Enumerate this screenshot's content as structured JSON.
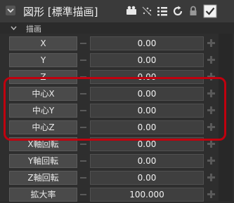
{
  "header": {
    "title": "図形 [標準描画]",
    "icons": [
      "camera-icon",
      "effect-icon",
      "list-icon",
      "refresh-icon",
      "lock-icon",
      "checkbox-icon"
    ]
  },
  "section": {
    "label": "描画"
  },
  "rows": [
    {
      "label": "X",
      "value": "0.00"
    },
    {
      "label": "Y",
      "value": "0.00"
    },
    {
      "label": "Z",
      "value": "0.00"
    },
    {
      "label": "中心X",
      "value": "0.00"
    },
    {
      "label": "中心Y",
      "value": "0.00"
    },
    {
      "label": "中心Z",
      "value": "0.00"
    },
    {
      "label": "X軸回転",
      "value": "0.00"
    },
    {
      "label": "Y軸回転",
      "value": "0.00"
    },
    {
      "label": "Z軸回転",
      "value": "0.00"
    },
    {
      "label": "拡大率",
      "value": "100.000"
    }
  ],
  "colors": {
    "highlight": "#c0000e",
    "panel": "#2e2e2e"
  }
}
